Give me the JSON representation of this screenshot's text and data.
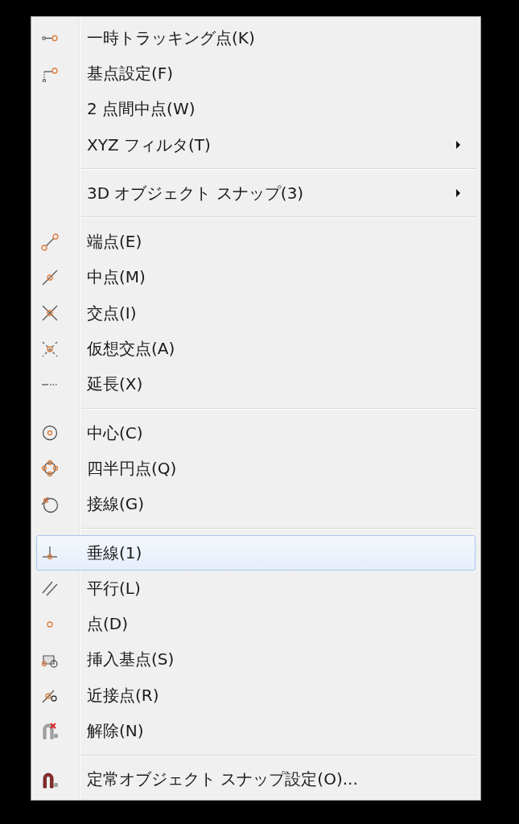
{
  "menu": {
    "entries": [
      {
        "kind": "item",
        "label": "一時トラッキング点(K)",
        "submenu": false,
        "selected": false
      },
      {
        "kind": "item",
        "label": "基点設定(F)",
        "submenu": false,
        "selected": false
      },
      {
        "kind": "item",
        "label": "2 点間中点(W)",
        "submenu": false,
        "selected": false
      },
      {
        "kind": "item",
        "label": "XYZ フィルタ(T)",
        "submenu": true,
        "selected": false
      },
      {
        "kind": "separator"
      },
      {
        "kind": "item",
        "label": "3D オブジェクト スナップ(3)",
        "submenu": true,
        "selected": false
      },
      {
        "kind": "separator"
      },
      {
        "kind": "item",
        "label": "端点(E)",
        "submenu": false,
        "selected": false
      },
      {
        "kind": "item",
        "label": "中点(M)",
        "submenu": false,
        "selected": false
      },
      {
        "kind": "item",
        "label": "交点(I)",
        "submenu": false,
        "selected": false
      },
      {
        "kind": "item",
        "label": "仮想交点(A)",
        "submenu": false,
        "selected": false
      },
      {
        "kind": "item",
        "label": "延長(X)",
        "submenu": false,
        "selected": false
      },
      {
        "kind": "separator"
      },
      {
        "kind": "item",
        "label": "中心(C)",
        "submenu": false,
        "selected": false
      },
      {
        "kind": "item",
        "label": "四半円点(Q)",
        "submenu": false,
        "selected": false
      },
      {
        "kind": "item",
        "label": "接線(G)",
        "submenu": false,
        "selected": false
      },
      {
        "kind": "separator"
      },
      {
        "kind": "item",
        "label": "垂線(1)",
        "submenu": false,
        "selected": true
      },
      {
        "kind": "item",
        "label": "平行(L)",
        "submenu": false,
        "selected": false
      },
      {
        "kind": "item",
        "label": "点(D)",
        "submenu": false,
        "selected": false
      },
      {
        "kind": "item",
        "label": "挿入基点(S)",
        "submenu": false,
        "selected": false
      },
      {
        "kind": "item",
        "label": "近接点(R)",
        "submenu": false,
        "selected": false
      },
      {
        "kind": "item",
        "label": "解除(N)",
        "submenu": false,
        "selected": false
      },
      {
        "kind": "separator"
      },
      {
        "kind": "item",
        "label": "定常オブジェクト スナップ設定(O)...",
        "submenu": false,
        "selected": false
      }
    ]
  }
}
